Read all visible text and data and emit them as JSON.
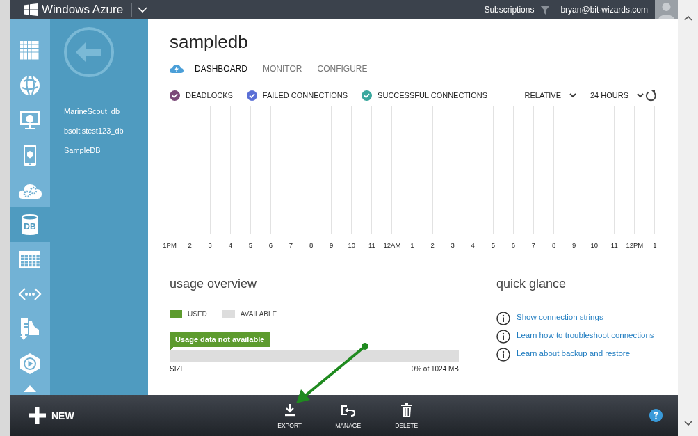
{
  "header": {
    "title": "Windows Azure",
    "subscriptions": "Subscriptions",
    "user": "bryan@bit-wizards.com"
  },
  "nav": {
    "items": [
      {
        "kind": "grid",
        "selected": false
      },
      {
        "kind": "globe",
        "selected": false
      },
      {
        "kind": "monitor",
        "selected": false
      },
      {
        "kind": "phone",
        "selected": false
      },
      {
        "kind": "cloud",
        "selected": false
      },
      {
        "kind": "database",
        "label": "DB",
        "selected": true
      },
      {
        "kind": "table",
        "selected": false
      },
      {
        "kind": "code",
        "selected": false
      },
      {
        "kind": "document",
        "selected": false
      },
      {
        "kind": "play",
        "selected": false
      },
      {
        "kind": "partial",
        "selected": false
      }
    ]
  },
  "databases": [
    {
      "name": "MarineScout_db"
    },
    {
      "name": "bsoltistest123_db"
    },
    {
      "name": "SampleDB"
    }
  ],
  "page": {
    "title": "sampledb",
    "tabs": [
      {
        "label": "DASHBOARD",
        "selected": true
      },
      {
        "label": "MONITOR",
        "selected": false
      },
      {
        "label": "CONFIGURE",
        "selected": false
      }
    ]
  },
  "chart": {
    "legend": [
      {
        "label": "DEADLOCKS",
        "checked": true,
        "color": "#7b4a78"
      },
      {
        "label": "FAILED CONNECTIONS",
        "checked": true,
        "color": "#5a6fd6"
      },
      {
        "label": "SUCCESSFUL CONNECTIONS",
        "checked": true,
        "color": "#3aa89e"
      }
    ],
    "range_mode": "RELATIVE",
    "range": "24 HOURS",
    "x_axis_labels": [
      "1PM",
      "2",
      "3",
      "4",
      "5",
      "6",
      "7",
      "8",
      "9",
      "10",
      "11",
      "12AM",
      "1",
      "2",
      "3",
      "4",
      "5",
      "6",
      "7",
      "8",
      "9",
      "10",
      "11",
      "12PM",
      "1"
    ]
  },
  "usage": {
    "title": "usage overview",
    "legend": [
      {
        "label": "USED",
        "color": "#5d9b2e"
      },
      {
        "label": "AVAILABLE",
        "color": "#dddddd"
      }
    ],
    "message": "Usage data not available",
    "bars": [
      {
        "label": "SIZE",
        "level": 0,
        "reading": "0% of 1024 MB"
      }
    ]
  },
  "quick_glance": {
    "title": "quick glance",
    "links": [
      "Show connection strings",
      "Learn how to troubleshoot connections",
      "Learn about backup and restore"
    ]
  },
  "commands": {
    "new": "NEW",
    "actions": [
      {
        "kind": "export",
        "label": "EXPORT"
      },
      {
        "kind": "manage",
        "label": "MANAGE"
      },
      {
        "kind": "delete",
        "label": "DELETE"
      }
    ]
  }
}
